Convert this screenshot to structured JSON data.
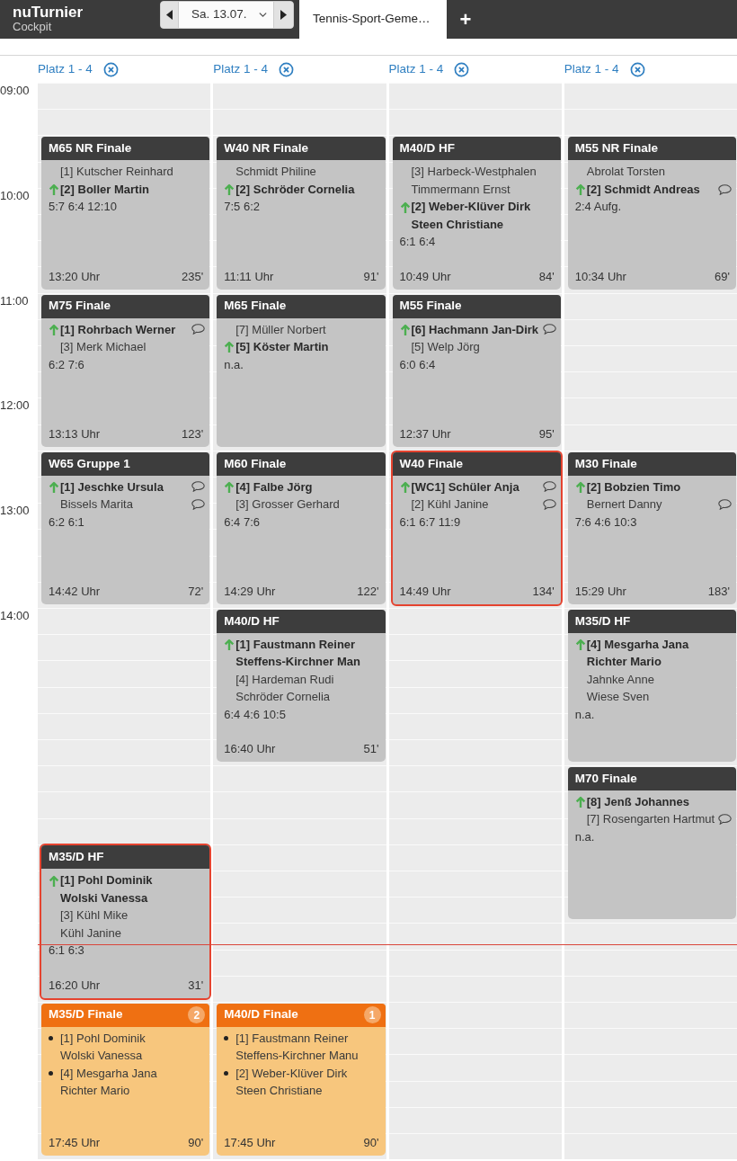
{
  "app": {
    "name": "nuTurnier",
    "subtitle": "Cockpit"
  },
  "date_picker": {
    "value": "Sa. 13.07."
  },
  "tabs": [
    {
      "label": "Tennis-Sport-Geme…",
      "selected": true
    }
  ],
  "add_tab": {
    "label": "+"
  },
  "schedule": {
    "hours": [
      "09:00",
      "10:00",
      "11:00",
      "12:00",
      "13:00",
      "14:00"
    ],
    "courts": [
      {
        "label": "Platz 1 - 4",
        "matches": [
          {
            "kind": "played",
            "title": "M65 NR Finale",
            "highlighted": false,
            "sides": [
              {
                "winner": false,
                "players": [
                  {
                    "name": "[1] Kutscher Reinhard",
                    "comment": false
                  }
                ]
              },
              {
                "winner": true,
                "players": [
                  {
                    "name": "[2] Boller Martin",
                    "comment": false
                  }
                ]
              }
            ],
            "score": "5:7 6:4 12:10",
            "time": "13:20 Uhr",
            "duration": "235'"
          },
          {
            "kind": "played",
            "title": "M75 Finale",
            "highlighted": false,
            "sides": [
              {
                "winner": true,
                "players": [
                  {
                    "name": "[1] Rohrbach Werner",
                    "comment": true
                  }
                ]
              },
              {
                "winner": false,
                "players": [
                  {
                    "name": "[3] Merk Michael",
                    "comment": false
                  }
                ]
              }
            ],
            "score": "6:2 7:6",
            "time": "13:13 Uhr",
            "duration": "123'"
          },
          {
            "kind": "played",
            "title": "W65 Gruppe 1",
            "highlighted": false,
            "sides": [
              {
                "winner": true,
                "players": [
                  {
                    "name": "[1] Jeschke Ursula",
                    "comment": true
                  }
                ]
              },
              {
                "winner": false,
                "players": [
                  {
                    "name": "Bissels Marita",
                    "comment": true
                  }
                ]
              }
            ],
            "score": "6:2 6:1",
            "time": "14:42 Uhr",
            "duration": "72'"
          },
          {
            "kind": "played",
            "title": "M35/D HF",
            "highlighted": true,
            "sides": [
              {
                "winner": true,
                "players": [
                  {
                    "name": "[1] Pohl Dominik",
                    "comment": false
                  },
                  {
                    "name": "Wolski Vanessa",
                    "comment": false
                  }
                ]
              },
              {
                "winner": false,
                "players": [
                  {
                    "name": "[3] Kühl Mike",
                    "comment": false
                  },
                  {
                    "name": "Kühl Janine",
                    "comment": false
                  }
                ]
              }
            ],
            "score": "6:1 6:3",
            "time": "16:20 Uhr",
            "duration": "31'"
          },
          {
            "kind": "scheduled",
            "title": "M35/D Finale",
            "badge": "2",
            "highlighted": false,
            "sides": [
              {
                "players": [
                  {
                    "name": "[1] Pohl Dominik",
                    "comment": false
                  },
                  {
                    "name": "Wolski Vanessa",
                    "comment": false
                  }
                ]
              },
              {
                "players": [
                  {
                    "name": "[4] Mesgarha Jana",
                    "comment": false
                  },
                  {
                    "name": "Richter Mario",
                    "comment": false
                  }
                ]
              }
            ],
            "time": "17:45 Uhr",
            "duration": "90'"
          }
        ]
      },
      {
        "label": "Platz 1 - 4",
        "matches": [
          {
            "kind": "played",
            "title": "W40 NR Finale",
            "highlighted": false,
            "sides": [
              {
                "winner": false,
                "players": [
                  {
                    "name": "Schmidt Philine",
                    "comment": false
                  }
                ]
              },
              {
                "winner": true,
                "players": [
                  {
                    "name": "[2] Schröder Cornelia",
                    "comment": false
                  }
                ]
              }
            ],
            "score": "7:5 6:2",
            "time": "11:11 Uhr",
            "duration": "91'"
          },
          {
            "kind": "played",
            "title": "M65 Finale",
            "highlighted": false,
            "sides": [
              {
                "winner": false,
                "players": [
                  {
                    "name": "[7] Müller Norbert",
                    "comment": false
                  }
                ]
              },
              {
                "winner": true,
                "players": [
                  {
                    "name": "[5] Köster Martin",
                    "comment": false
                  }
                ]
              }
            ],
            "score": "n.a."
          },
          {
            "kind": "played",
            "title": "M60 Finale",
            "highlighted": false,
            "sides": [
              {
                "winner": true,
                "players": [
                  {
                    "name": "[4] Falbe Jörg",
                    "comment": false
                  }
                ]
              },
              {
                "winner": false,
                "players": [
                  {
                    "name": "[3] Grosser Gerhard",
                    "comment": false
                  }
                ]
              }
            ],
            "score": "6:4 7:6",
            "time": "14:29 Uhr",
            "duration": "122'"
          },
          {
            "kind": "played",
            "title": "M40/D HF",
            "highlighted": false,
            "sides": [
              {
                "winner": true,
                "players": [
                  {
                    "name": "[1] Faustmann Reiner",
                    "comment": false
                  },
                  {
                    "name": "Steffens-Kirchner Man",
                    "comment": false
                  }
                ]
              },
              {
                "winner": false,
                "players": [
                  {
                    "name": "[4] Hardeman Rudi",
                    "comment": false
                  },
                  {
                    "name": "Schröder Cornelia",
                    "comment": false
                  }
                ]
              }
            ],
            "score": "6:4 4:6 10:5",
            "time": "16:40 Uhr",
            "duration": "51'"
          },
          {
            "kind": "scheduled",
            "title": "M40/D Finale",
            "badge": "1",
            "highlighted": false,
            "sides": [
              {
                "players": [
                  {
                    "name": "[1] Faustmann Reiner",
                    "comment": false
                  },
                  {
                    "name": "Steffens-Kirchner Manu",
                    "comment": false
                  }
                ]
              },
              {
                "players": [
                  {
                    "name": "[2] Weber-Klüver Dirk",
                    "comment": false
                  },
                  {
                    "name": "Steen Christiane",
                    "comment": false
                  }
                ]
              }
            ],
            "time": "17:45 Uhr",
            "duration": "90'"
          }
        ]
      },
      {
        "label": "Platz 1 - 4",
        "matches": [
          {
            "kind": "played",
            "title": "M40/D HF",
            "highlighted": false,
            "sides": [
              {
                "winner": false,
                "players": [
                  {
                    "name": "[3] Harbeck-Westphalen",
                    "comment": false
                  },
                  {
                    "name": "Timmermann Ernst",
                    "comment": false
                  }
                ]
              },
              {
                "winner": true,
                "players": [
                  {
                    "name": "[2] Weber-Klüver Dirk",
                    "comment": false
                  },
                  {
                    "name": "Steen Christiane",
                    "comment": false
                  }
                ]
              }
            ],
            "score": "6:1 6:4",
            "time": "10:49 Uhr",
            "duration": "84'"
          },
          {
            "kind": "played",
            "title": "M55 Finale",
            "highlighted": false,
            "sides": [
              {
                "winner": true,
                "players": [
                  {
                    "name": "[6] Hachmann Jan-Dirk",
                    "comment": true
                  }
                ]
              },
              {
                "winner": false,
                "players": [
                  {
                    "name": "[5] Welp Jörg",
                    "comment": false
                  }
                ]
              }
            ],
            "score": "6:0 6:4",
            "time": "12:37 Uhr",
            "duration": "95'"
          },
          {
            "kind": "played",
            "title": "W40 Finale",
            "highlighted": true,
            "sides": [
              {
                "winner": true,
                "players": [
                  {
                    "name": "[WC1] Schüler Anja",
                    "comment": true
                  }
                ]
              },
              {
                "winner": false,
                "players": [
                  {
                    "name": "[2] Kühl Janine",
                    "comment": true
                  }
                ]
              }
            ],
            "score": "6:1 6:7 11:9",
            "time": "14:49 Uhr",
            "duration": "134'"
          }
        ]
      },
      {
        "label": "Platz 1 - 4",
        "matches": [
          {
            "kind": "played",
            "title": "M55 NR Finale",
            "highlighted": false,
            "sides": [
              {
                "winner": false,
                "players": [
                  {
                    "name": "Abrolat Torsten",
                    "comment": false
                  }
                ]
              },
              {
                "winner": true,
                "players": [
                  {
                    "name": "[2] Schmidt Andreas",
                    "comment": true
                  }
                ]
              }
            ],
            "score": "2:4 Aufg.",
            "time": "10:34 Uhr",
            "duration": "69'"
          },
          {
            "kind": "played",
            "title": "M30 Finale",
            "highlighted": false,
            "sides": [
              {
                "winner": true,
                "players": [
                  {
                    "name": "[2] Bobzien Timo",
                    "comment": false
                  }
                ]
              },
              {
                "winner": false,
                "players": [
                  {
                    "name": "Bernert Danny",
                    "comment": true
                  }
                ]
              }
            ],
            "score": "7:6 4:6 10:3",
            "time": "15:29 Uhr",
            "duration": "183'"
          },
          {
            "kind": "played",
            "title": "M35/D HF",
            "highlighted": false,
            "sides": [
              {
                "winner": true,
                "players": [
                  {
                    "name": "[4] Mesgarha Jana",
                    "comment": false
                  },
                  {
                    "name": "Richter Mario",
                    "comment": false
                  }
                ]
              },
              {
                "winner": false,
                "players": [
                  {
                    "name": "Jahnke Anne",
                    "comment": false
                  },
                  {
                    "name": "Wiese Sven",
                    "comment": false
                  }
                ]
              }
            ],
            "score": "n.a."
          },
          {
            "kind": "played",
            "title": "M70 Finale",
            "highlighted": false,
            "sides": [
              {
                "winner": true,
                "players": [
                  {
                    "name": "[8] Jenß Johannes",
                    "comment": false
                  }
                ]
              },
              {
                "winner": false,
                "players": [
                  {
                    "name": "[7] Rosengarten Hartmut",
                    "comment": true
                  }
                ]
              }
            ],
            "score": "n.a."
          }
        ]
      }
    ]
  }
}
